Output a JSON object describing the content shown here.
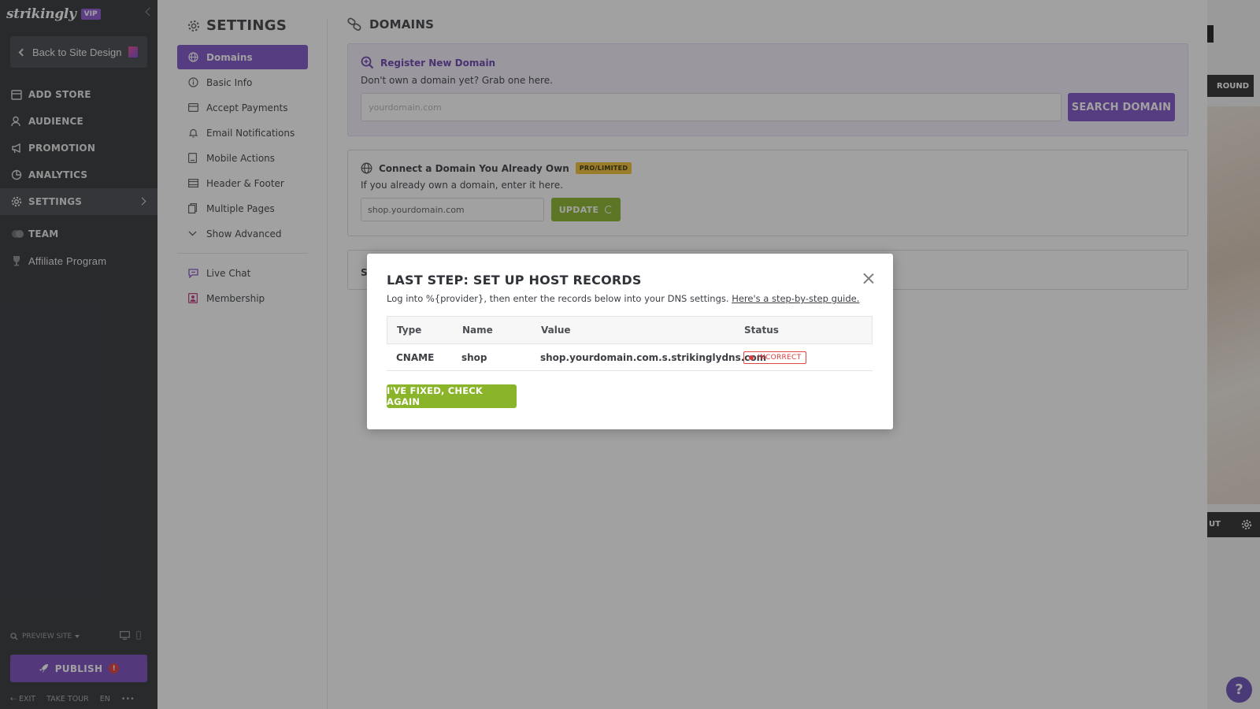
{
  "brand": {
    "logo": "strikingly",
    "badge": "VIP"
  },
  "sidebar": {
    "back_label": "Back to Site Design",
    "items": [
      {
        "label": "ADD STORE",
        "icon": "store-icon"
      },
      {
        "label": "AUDIENCE",
        "icon": "audience-icon"
      },
      {
        "label": "PROMOTION",
        "icon": "megaphone-icon"
      },
      {
        "label": "ANALYTICS",
        "icon": "chart-icon"
      },
      {
        "label": "SETTINGS",
        "icon": "gear-icon"
      },
      {
        "label": "TEAM",
        "icon": "team-icon"
      },
      {
        "label": "Affiliate Program",
        "icon": "trophy-icon"
      }
    ],
    "preview_label": "PREVIEW SITE",
    "publish_label": "PUBLISH",
    "publish_alert": "!",
    "footer": {
      "exit": "EXIT",
      "tour": "TAKE TOUR",
      "lang": "EN",
      "more": "•••"
    }
  },
  "settings": {
    "title": "SETTINGS",
    "nav": [
      {
        "label": "Domains",
        "active": true
      },
      {
        "label": "Basic Info"
      },
      {
        "label": "Accept Payments"
      },
      {
        "label": "Email Notifications"
      },
      {
        "label": "Mobile Actions"
      },
      {
        "label": "Header & Footer"
      },
      {
        "label": "Multiple Pages"
      },
      {
        "label": "Show Advanced"
      }
    ],
    "nav_extra": [
      {
        "label": "Live Chat"
      },
      {
        "label": "Membership"
      }
    ]
  },
  "domains": {
    "title": "DOMAINS",
    "register": {
      "title": "Register New Domain",
      "subtitle": "Don't own a domain yet? Grab one here.",
      "placeholder": "yourdomain.com",
      "button": "SEARCH DOMAIN"
    },
    "connect": {
      "title": "Connect a Domain You Already Own",
      "badge": "PRO/LIMITED",
      "subtitle": "If you already own a domain, enter it here.",
      "value": "shop.yourdomain.com",
      "button": "UPDATE"
    },
    "third_card_initial": "S"
  },
  "site_preview": {
    "bg_button": "ROUND",
    "bar_label": "UT",
    "help": "?"
  },
  "modal": {
    "title": "LAST STEP: SET UP HOST RECORDS",
    "desc": "Log into %{provider}, then enter the records below into your DNS settings.",
    "guide_link": "Here's a step-by-step guide.",
    "columns": [
      "Type",
      "Name",
      "Value",
      "Status"
    ],
    "rows": [
      {
        "type": "CNAME",
        "name": "shop",
        "value": "shop.yourdomain.com.s.strikinglydns.com",
        "status": "INCORRECT"
      }
    ],
    "check_button": "I'VE FIXED, CHECK AGAIN"
  },
  "colors": {
    "purple": "#7e52c6",
    "green": "#8ab52a",
    "sidebar": "#303236",
    "error": "#d93b3b",
    "pro_badge": "#f1c232"
  }
}
